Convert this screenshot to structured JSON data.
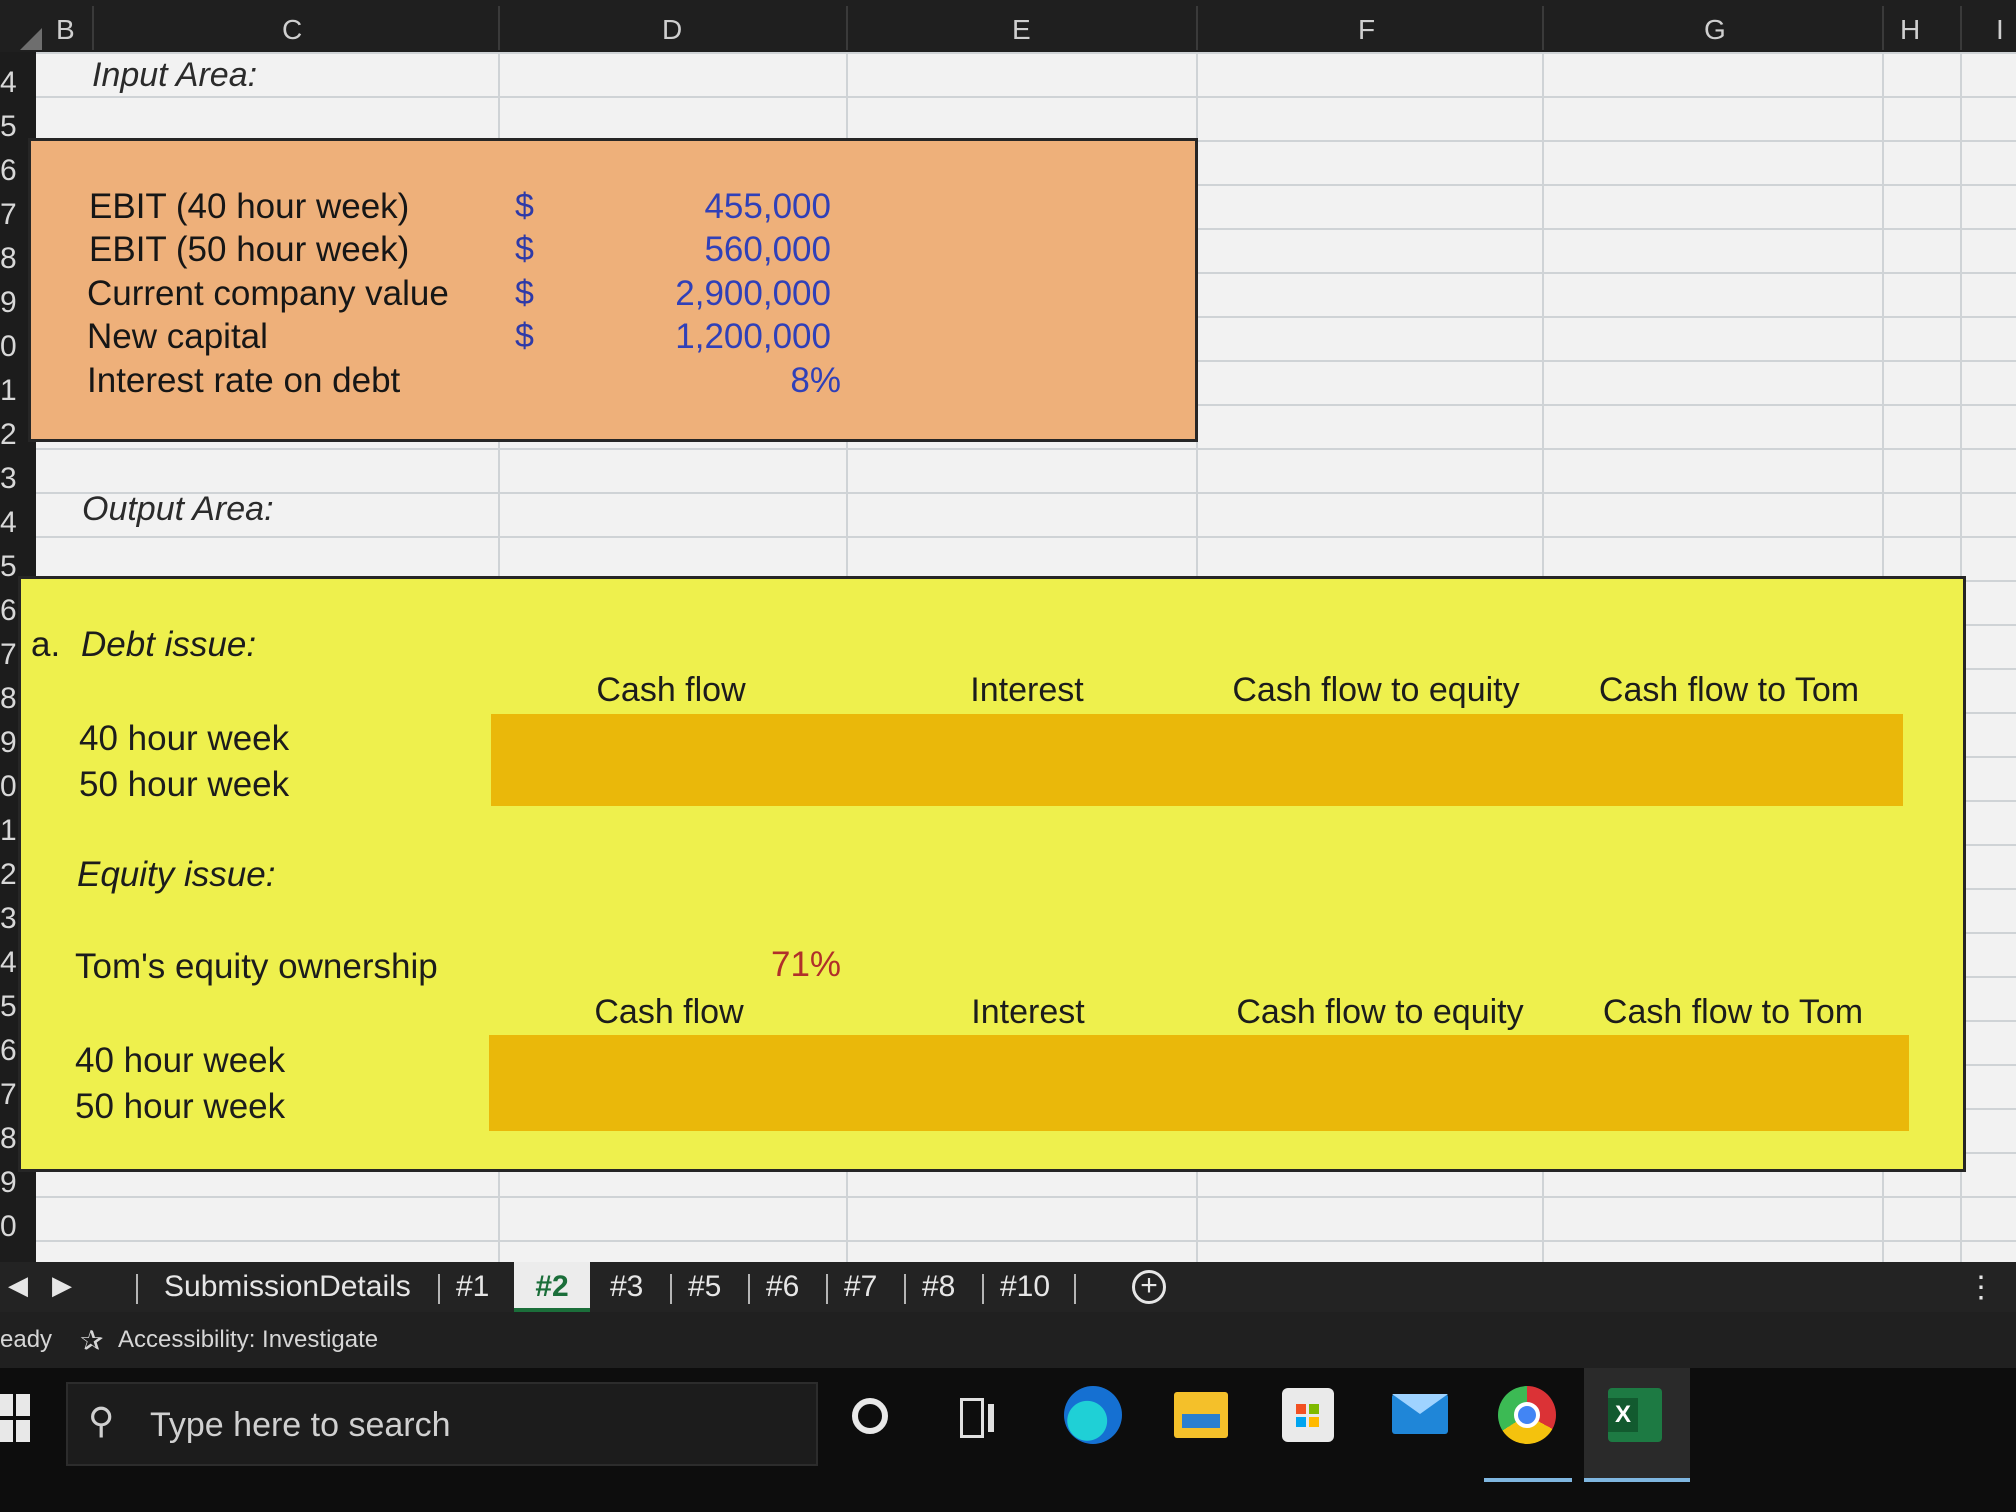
{
  "columns": [
    "B",
    "C",
    "D",
    "E",
    "F",
    "G",
    "H",
    "I"
  ],
  "rows": [
    "4",
    "5",
    "6",
    "7",
    "8",
    "9",
    "0",
    "1",
    "2",
    "3",
    "4",
    "5",
    "6",
    "7",
    "8",
    "9",
    "0",
    "1",
    "2",
    "3",
    "4",
    "5",
    "6",
    "7",
    "8",
    "9",
    "0"
  ],
  "input_area": {
    "title": "Input Area:",
    "items": [
      {
        "label": "EBIT (40 hour week)",
        "currency": "$",
        "value": "455,000"
      },
      {
        "label": "EBIT (50 hour week)",
        "currency": "$",
        "value": "560,000"
      },
      {
        "label": "Current company value",
        "currency": "$",
        "value": "2,900,000"
      },
      {
        "label": "New capital",
        "currency": "$",
        "value": "1,200,000"
      },
      {
        "label": "Interest rate on debt",
        "currency": "",
        "value": "8%"
      }
    ]
  },
  "output_area": {
    "title": "Output Area:",
    "debt": {
      "prefix": "a.",
      "heading": "Debt issue:",
      "columns": [
        "Cash flow",
        "Interest",
        "Cash flow to equity",
        "Cash flow to Tom"
      ],
      "rows": [
        "40 hour week",
        "50 hour week"
      ]
    },
    "equity": {
      "heading": "Equity issue:",
      "ownership_label": "Tom's equity ownership",
      "ownership_value": "71%",
      "columns": [
        "Cash flow",
        "Interest",
        "Cash flow to equity",
        "Cash flow to Tom"
      ],
      "rows": [
        "40 hour week",
        "50 hour week"
      ]
    }
  },
  "sheet_tabs": {
    "tabs": [
      "SubmissionDetails",
      "#1",
      "#2",
      "#3",
      "#5",
      "#6",
      "#7",
      "#8",
      "#10"
    ],
    "active": "#2",
    "add_symbol": "+"
  },
  "status_bar": {
    "ready": "eady",
    "accessibility": "Accessibility: Investigate"
  },
  "taskbar": {
    "search_placeholder": "Type here to search",
    "apps": [
      "cortana-icon",
      "task-view-icon",
      "edge-icon",
      "file-explorer-icon",
      "store-icon",
      "mail-icon",
      "chrome-icon",
      "excel-icon"
    ]
  },
  "colors": {
    "input_fill": "#eeb07a",
    "output_fill": "#eef04d",
    "band_fill": "#eab80a",
    "input_value_blue": "#3040b8",
    "ownership_red": "#b0302a",
    "active_tab_green": "#1b6e3a"
  }
}
